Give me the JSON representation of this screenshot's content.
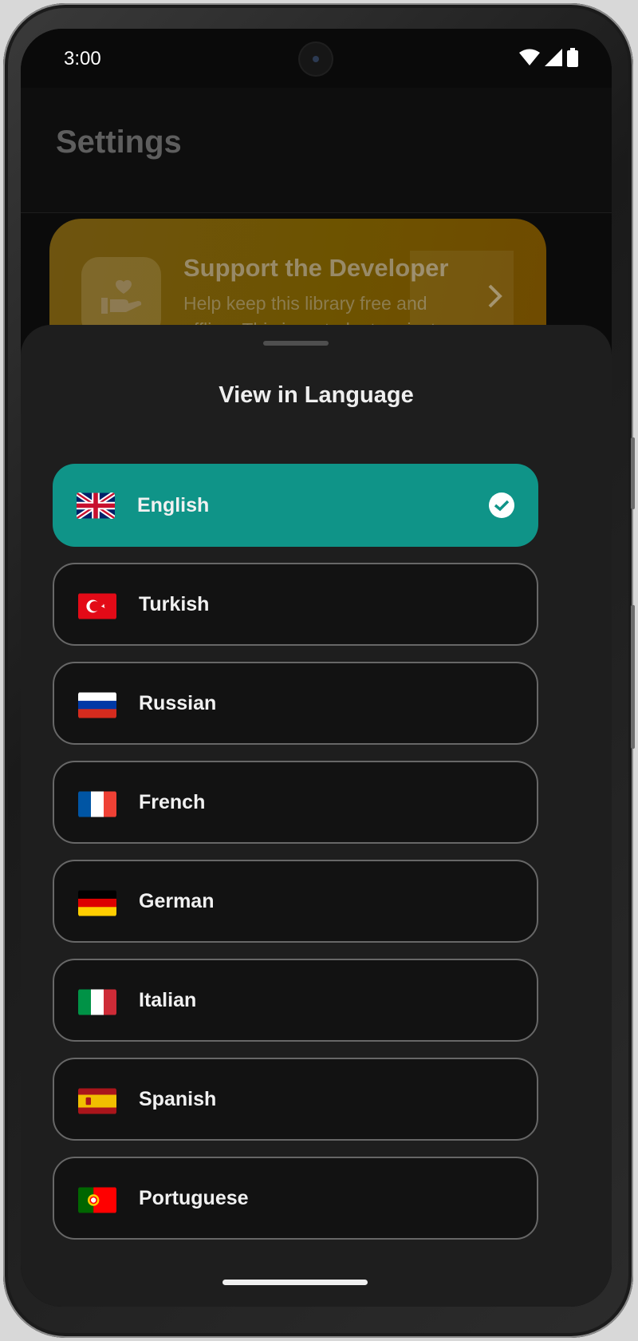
{
  "status_bar": {
    "time": "3:00",
    "icons": [
      "wifi-icon",
      "signal-icon",
      "battery-icon"
    ]
  },
  "header": {
    "title": "Settings"
  },
  "support_card": {
    "title": "Support the Developer",
    "description": "Help keep this library free and offline. This is a student project.",
    "icon": "donate-hand-heart-icon"
  },
  "language_sheet": {
    "title": "View in Language",
    "selected": "English",
    "languages": [
      {
        "label": "English",
        "flag": "uk-flag-icon",
        "selected": true
      },
      {
        "label": "Turkish",
        "flag": "turkey-flag-icon",
        "selected": false
      },
      {
        "label": "Russian",
        "flag": "russia-flag-icon",
        "selected": false
      },
      {
        "label": "French",
        "flag": "france-flag-icon",
        "selected": false
      },
      {
        "label": "German",
        "flag": "germany-flag-icon",
        "selected": false
      },
      {
        "label": "Italian",
        "flag": "italy-flag-icon",
        "selected": false
      },
      {
        "label": "Spanish",
        "flag": "spain-flag-icon",
        "selected": false
      },
      {
        "label": "Portuguese",
        "flag": "portugal-flag-icon",
        "selected": false
      }
    ]
  },
  "colors": {
    "accent": "#0f9488",
    "sheet_background": "#1e1e1e",
    "item_background": "#121212",
    "item_border": "#676767"
  }
}
